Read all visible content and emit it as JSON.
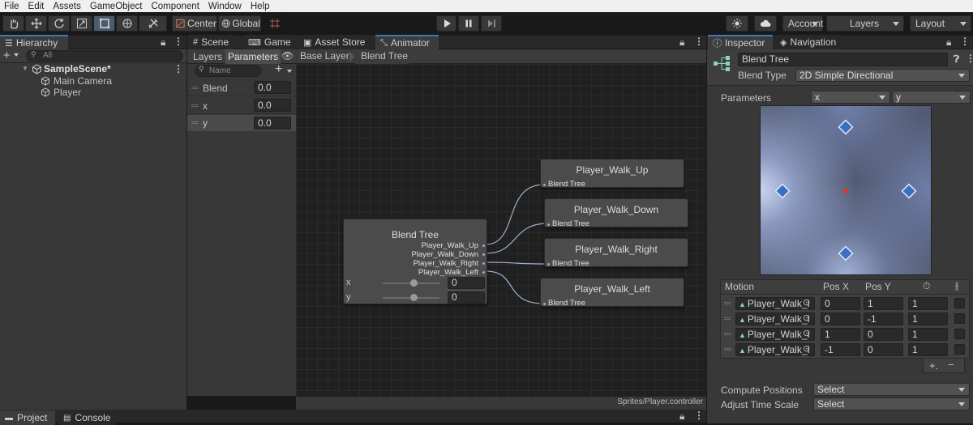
{
  "menu": [
    "File",
    "Edit",
    "Assets",
    "GameObject",
    "Component",
    "Window",
    "Help"
  ],
  "toolbar": {
    "pivot": "Center",
    "space": "Global",
    "account": "Account",
    "layers": "Layers",
    "layout": "Layout"
  },
  "hierarchy": {
    "tab": "Hierarchy",
    "search_placeholder": "All",
    "scene": "SampleScene*",
    "items": [
      "Main Camera",
      "Player"
    ]
  },
  "center_tabs": [
    "Scene",
    "Game",
    "Asset Store",
    "Animator"
  ],
  "animator": {
    "subtabs": [
      "Layers",
      "Parameters"
    ],
    "breadcrumb": [
      "Base Layer",
      "Blend Tree"
    ],
    "search_placeholder": "Name",
    "params": [
      {
        "name": "Blend",
        "value": "0.0"
      },
      {
        "name": "x",
        "value": "0.0"
      },
      {
        "name": "y",
        "value": "0.0"
      }
    ],
    "blend_node": {
      "title": "Blend Tree",
      "outputs": [
        "Player_Walk_Up",
        "Player_Walk_Down",
        "Player_Walk_Right",
        "Player_Walk_Left"
      ],
      "params": [
        {
          "name": "x",
          "value": "0"
        },
        {
          "name": "y",
          "value": "0"
        }
      ]
    },
    "clip_nodes": [
      {
        "title": "Player_Walk_Up",
        "port": "Blend Tree"
      },
      {
        "title": "Player_Walk_Down",
        "port": "Blend Tree"
      },
      {
        "title": "Player_Walk_Right",
        "port": "Blend Tree"
      },
      {
        "title": "Player_Walk_Left",
        "port": "Blend Tree"
      }
    ],
    "footer": "Sprites/Player.controller"
  },
  "bottom_tabs": [
    "Project",
    "Console"
  ],
  "inspector": {
    "tabs": [
      "Inspector",
      "Navigation"
    ],
    "name": "Blend Tree",
    "blend_type_label": "Blend Type",
    "blend_type": "2D Simple Directional",
    "parameters_label": "Parameters",
    "param_x": "x",
    "param_y": "y",
    "motion_headers": {
      "motion": "Motion",
      "posx": "Pos X",
      "posy": "Pos Y"
    },
    "motions": [
      {
        "clip": "Player_Walk_I",
        "x": "0",
        "y": "1",
        "speed": "1"
      },
      {
        "clip": "Player_Walk_I",
        "x": "0",
        "y": "-1",
        "speed": "1"
      },
      {
        "clip": "Player_Walk_I",
        "x": "1",
        "y": "0",
        "speed": "1"
      },
      {
        "clip": "Player_Walk_I",
        "x": "-1",
        "y": "0",
        "speed": "1"
      }
    ],
    "compute_label": "Compute Positions",
    "compute_value": "Select",
    "adjust_label": "Adjust Time Scale",
    "adjust_value": "Select",
    "add_symbol": "+.",
    "remove_symbol": "−"
  },
  "colors": {
    "accent": "#3a79bb",
    "selection": "#4b5c6f",
    "graph_bg": "#202020",
    "node": "#4b4b4b"
  }
}
